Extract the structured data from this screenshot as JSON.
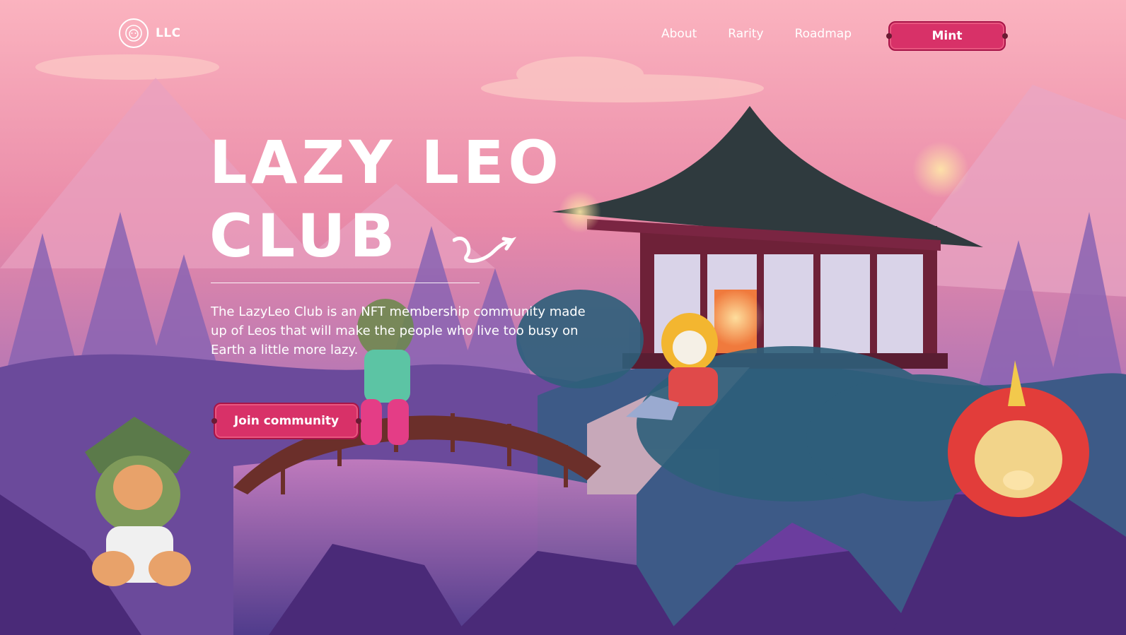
{
  "brand": {
    "logo_text": "LLC",
    "logo_icon": "lion-head-icon"
  },
  "nav": {
    "items": [
      {
        "label": "About"
      },
      {
        "label": "Rarity"
      },
      {
        "label": "Roadmap"
      }
    ],
    "mint_label": "Mint"
  },
  "hero": {
    "title_line1": "LAZY LEO",
    "title_line2": "CLUB",
    "description": "The LazyLeo Club is an NFT membership community made up of Leos that will make the people who live too busy on Earth a little more lazy.",
    "cta_label": "Join community"
  },
  "colors": {
    "accent": "#d83168",
    "sky_top": "#f7a9b8",
    "sky_bottom": "#9a5fb0",
    "rock": "#5a2f86",
    "text": "#ffffff"
  }
}
